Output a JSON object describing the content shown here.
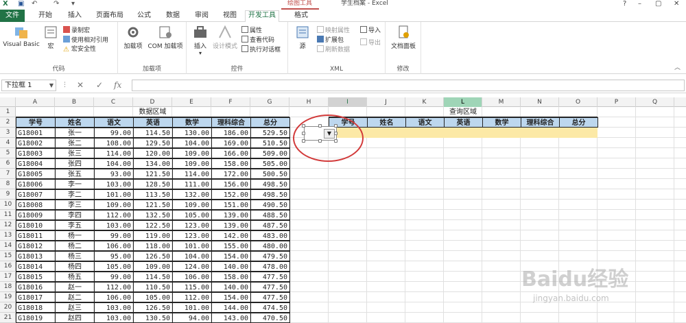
{
  "window": {
    "title": "学生档案 - Excel",
    "context_tab_group": "绘图工具",
    "controls": [
      "?",
      "–",
      "▢",
      "✕"
    ]
  },
  "tabs": [
    {
      "label": "文件",
      "id": "file"
    },
    {
      "label": "开始",
      "id": "home"
    },
    {
      "label": "插入",
      "id": "insert"
    },
    {
      "label": "页面布局",
      "id": "layout"
    },
    {
      "label": "公式",
      "id": "formulas"
    },
    {
      "label": "数据",
      "id": "data"
    },
    {
      "label": "审阅",
      "id": "review"
    },
    {
      "label": "视图",
      "id": "view"
    },
    {
      "label": "开发工具",
      "id": "developer",
      "active": true
    },
    {
      "label": "格式",
      "id": "format"
    }
  ],
  "ribbon": {
    "code": {
      "label": "代码",
      "visual_basic": "Visual Basic",
      "macros": "宏",
      "record_macro": "录制宏",
      "relative_ref": "使用相对引用",
      "macro_security": "宏安全性"
    },
    "addins": {
      "label": "加载项",
      "addins": "加载项",
      "com_addins": "COM 加载项"
    },
    "controls": {
      "label": "控件",
      "insert": "插入",
      "design_mode": "设计模式",
      "properties": "属性",
      "view_code": "查看代码",
      "run_dialog": "执行对话框"
    },
    "xml": {
      "label": "XML",
      "source": "源",
      "map_properties": "映射属性",
      "expansion_packs": "扩展包",
      "refresh_data": "刷新数据",
      "import": "导入",
      "export": "导出"
    },
    "modify": {
      "label": "修改",
      "doc_panel": "文档面板"
    }
  },
  "formula_bar": {
    "name_box": "下拉框 1",
    "formula": ""
  },
  "columns": [
    "A",
    "B",
    "C",
    "D",
    "E",
    "F",
    "G",
    "H",
    "I",
    "J",
    "K",
    "L",
    "M",
    "N",
    "O",
    "P",
    "Q"
  ],
  "rows": [
    "1",
    "2",
    "3",
    "4",
    "5",
    "6",
    "7",
    "8",
    "9",
    "10",
    "11",
    "12",
    "13",
    "14",
    "15",
    "16",
    "17",
    "18",
    "19",
    "20",
    "21"
  ],
  "sheet": {
    "data_title": "数据区域",
    "query_title": "查询区域",
    "headers": [
      "学号",
      "姓名",
      "语文",
      "英语",
      "数学",
      "理科综合",
      "总分"
    ],
    "query_headers": [
      "学号",
      "姓名",
      "语文",
      "英语",
      "数学",
      "理科综合",
      "总分"
    ],
    "records": [
      [
        "G18001",
        "张一",
        "99.00",
        "114.50",
        "130.00",
        "186.00",
        "529.50"
      ],
      [
        "G18002",
        "张二",
        "108.00",
        "129.50",
        "104.00",
        "169.00",
        "510.50"
      ],
      [
        "G18003",
        "张三",
        "114.00",
        "120.00",
        "109.00",
        "166.00",
        "509.00"
      ],
      [
        "G18004",
        "张四",
        "104.00",
        "134.00",
        "109.00",
        "158.00",
        "505.00"
      ],
      [
        "G18005",
        "张五",
        "93.00",
        "121.50",
        "114.00",
        "172.00",
        "500.50"
      ],
      [
        "G18006",
        "李一",
        "103.00",
        "128.50",
        "111.00",
        "156.00",
        "498.50"
      ],
      [
        "G18007",
        "李二",
        "101.00",
        "113.50",
        "132.00",
        "152.00",
        "498.50"
      ],
      [
        "G18008",
        "李三",
        "109.00",
        "121.50",
        "109.00",
        "151.00",
        "490.50"
      ],
      [
        "G18009",
        "李四",
        "112.00",
        "132.50",
        "105.00",
        "139.00",
        "488.50"
      ],
      [
        "G18010",
        "李五",
        "103.00",
        "122.50",
        "123.00",
        "139.00",
        "487.50"
      ],
      [
        "G18011",
        "杨一",
        "99.00",
        "119.00",
        "123.00",
        "142.00",
        "483.00"
      ],
      [
        "G18012",
        "杨二",
        "106.00",
        "118.00",
        "101.00",
        "155.00",
        "480.00"
      ],
      [
        "G18013",
        "杨三",
        "95.00",
        "126.50",
        "104.00",
        "154.00",
        "479.50"
      ],
      [
        "G18014",
        "杨四",
        "105.00",
        "109.00",
        "124.00",
        "140.00",
        "478.00"
      ],
      [
        "G18015",
        "杨五",
        "99.00",
        "114.50",
        "106.00",
        "158.00",
        "477.50"
      ],
      [
        "G18016",
        "赵一",
        "112.00",
        "110.50",
        "115.00",
        "140.00",
        "477.50"
      ],
      [
        "G18017",
        "赵二",
        "106.00",
        "105.00",
        "112.00",
        "154.00",
        "477.50"
      ],
      [
        "G18018",
        "赵三",
        "103.00",
        "126.50",
        "101.00",
        "144.00",
        "474.50"
      ],
      [
        "G18019",
        "赵四",
        "103.00",
        "130.50",
        "94.00",
        "143.00",
        "470.50"
      ]
    ]
  },
  "watermark": {
    "brand": "Baidu经验",
    "url": "jingyan.baidu.com"
  },
  "colors": {
    "accent": "#217346",
    "header_fill": "#bdd7ee",
    "query_row_fill": "#fce9a6",
    "annotation": "#d23a3a"
  }
}
